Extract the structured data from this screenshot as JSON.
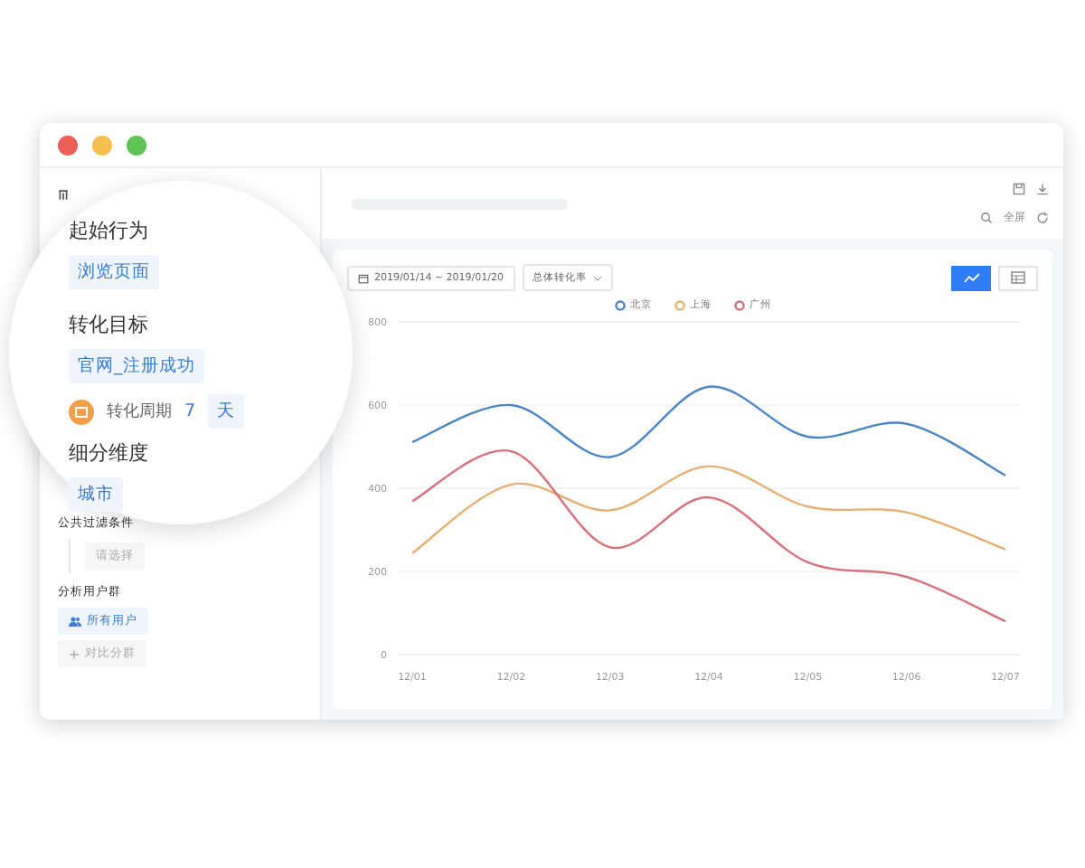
{
  "sidebar": {
    "filter_label": "公共过滤条件",
    "filter_placeholder": "请选择",
    "group_label": "分析用户群",
    "group_items": [
      {
        "kind": "users",
        "label": "所有用户"
      },
      {
        "kind": "add",
        "label": "对比分群"
      }
    ]
  },
  "magnifier": {
    "start_label": "起始行为",
    "start_value": "浏览页面",
    "goal_label": "转化目标",
    "goal_value": "官网_注册成功",
    "period_label": "转化周期",
    "period_value": "7",
    "period_unit": "天",
    "dimension_label": "细分维度",
    "dimension_value": "城市"
  },
  "toolbar": {
    "fullscreen": "全屏"
  },
  "filters": {
    "date_range": "2019/01/14 ~ 2019/01/20",
    "metric": "总体转化率"
  },
  "view_toggle": [
    {
      "kind": "line",
      "selected": true
    },
    {
      "kind": "table",
      "selected": false
    }
  ],
  "chart_data": {
    "type": "line",
    "categories": [
      "12/01",
      "12/02",
      "12/03",
      "12/04",
      "12/05",
      "12/06",
      "12/07"
    ],
    "ylim": [
      0,
      800
    ],
    "grid": true,
    "yticks": [
      0,
      200,
      400,
      600,
      800
    ],
    "series": [
      {
        "name": "北京",
        "color": "#4a86c8",
        "values": [
          511,
          600,
          475,
          644,
          524,
          555,
          431
        ]
      },
      {
        "name": "上海",
        "color": "#e8b070",
        "values": [
          244,
          409,
          347,
          453,
          356,
          342,
          253
        ]
      },
      {
        "name": "广州",
        "color": "#d9707a",
        "values": [
          369,
          489,
          258,
          378,
          222,
          187,
          80
        ]
      }
    ]
  }
}
